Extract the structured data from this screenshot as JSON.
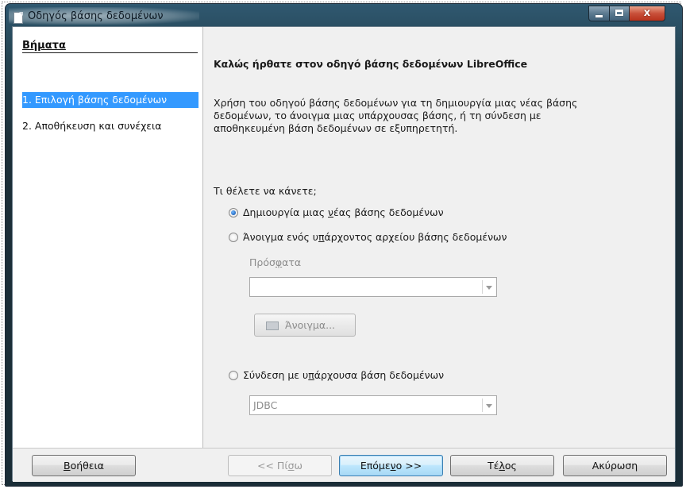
{
  "window": {
    "title": "Οδηγός βάσης δεδομένων",
    "controls": {
      "close_label": "x"
    }
  },
  "sidebar": {
    "heading": "Βήματα",
    "steps": [
      {
        "label": "1. Επιλογή βάσης δεδομένων",
        "active": true
      },
      {
        "label": "2. Αποθήκευση και συνέχεια",
        "active": false
      }
    ]
  },
  "main": {
    "heading": "Καλώς ήρθατε στον οδηγό βάσης δεδομένων LibreOffice",
    "description_lines": [
      "Χρήση του οδηγού βάσης δεδομένων για τη δημιουργία μιας νέας βάσης",
      "δεδομένων, το άνοιγμα μιας υπάρχουσας βάσης, ή τη σύνδεση με",
      "αποθηκευμένη βάση δεδομένων σε εξυπηρετητή."
    ],
    "question": "Τι θέλετε να κάνετε;",
    "options": {
      "create": {
        "pre": "Δημιουργία μιας ",
        "mnemonic": "ν",
        "post": "έας βάσης δεδομένων",
        "checked": true
      },
      "open": {
        "pre": "Άνοιγμα ενός υ",
        "mnemonic": "π",
        "post": "άρχοντος αρχείου βάσης δεδομένων",
        "checked": false
      },
      "connect": {
        "pre": "Σύνδεση με υ",
        "mnemonic": "π",
        "post": "άρχουσα βάση δεδομένων",
        "checked": false
      }
    },
    "recent": {
      "pre": "Πρόσ",
      "mnemonic": "φ",
      "post": "ατα",
      "value": ""
    },
    "open_button": {
      "label": "Άνοιγμα..."
    },
    "connection_type": {
      "value": "JDBC"
    }
  },
  "footer": {
    "help": {
      "mnemonic": "Β",
      "post": "οήθεια"
    },
    "back": {
      "pre": "<< Πί",
      "mnemonic": "σ",
      "post": "ω",
      "enabled": false
    },
    "next": {
      "pre": "Επόμε",
      "mnemonic": "ν",
      "post": "ο >>"
    },
    "finish": {
      "pre": "Τέ",
      "mnemonic": "λ",
      "post": "ος"
    },
    "cancel": {
      "label": "Ακύρωση"
    }
  },
  "colors": {
    "selection": "#3399ff",
    "dialog_bg": "#f0f0f0",
    "disabled_text": "#8c8c8c",
    "radio_checked": "#1c5fb6"
  }
}
